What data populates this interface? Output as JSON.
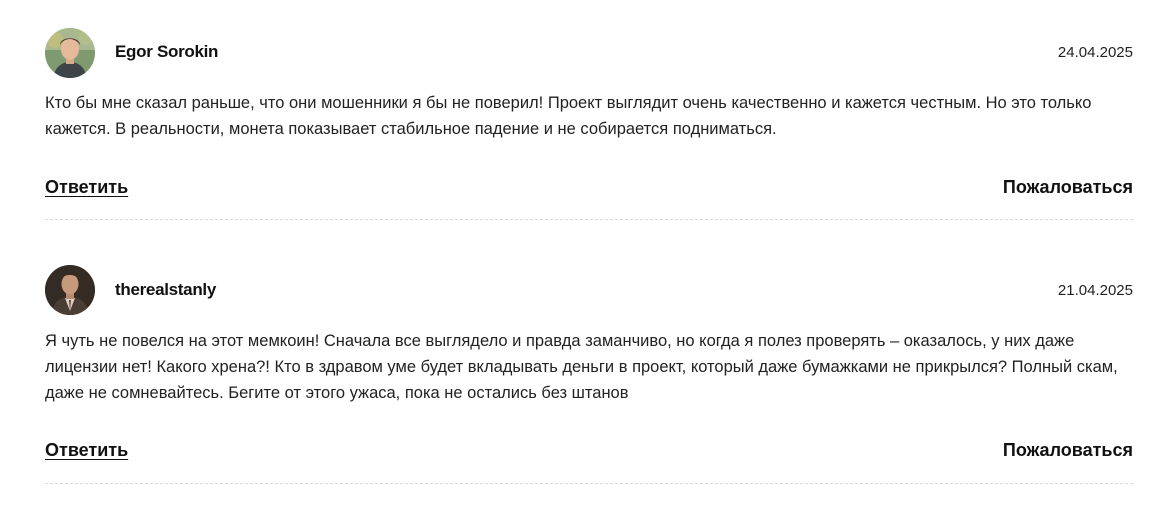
{
  "comments": [
    {
      "author": "Egor Sorokin",
      "date": "24.04.2025",
      "avatar_icon": "user-photo-avatar",
      "text": "Кто бы мне сказал раньше, что они мошенники я бы не поверил! Проект выглядит очень качественно и кажется честным. Но это только кажется. В реальности, монета показывает стабильное падение и не собирается подниматься.",
      "reply_label": "Ответить",
      "report_label": "Пожаловаться"
    },
    {
      "author": "therealstanly",
      "date": "21.04.2025",
      "avatar_icon": "user-photo-avatar",
      "text": "Я чуть не повелся на этот мемкоин! Сначала все выглядело и правда заманчиво, но когда я полез проверять – оказалось, у них даже лицензии нет! Какого хрена?! Кто в здравом уме будет вкладывать деньги в проект, который даже бумажками не прикрылся? Полный скам, даже не сомневайтесь. Бегите от этого ужаса, пока не остались без штанов",
      "reply_label": "Ответить",
      "report_label": "Пожаловаться"
    }
  ]
}
